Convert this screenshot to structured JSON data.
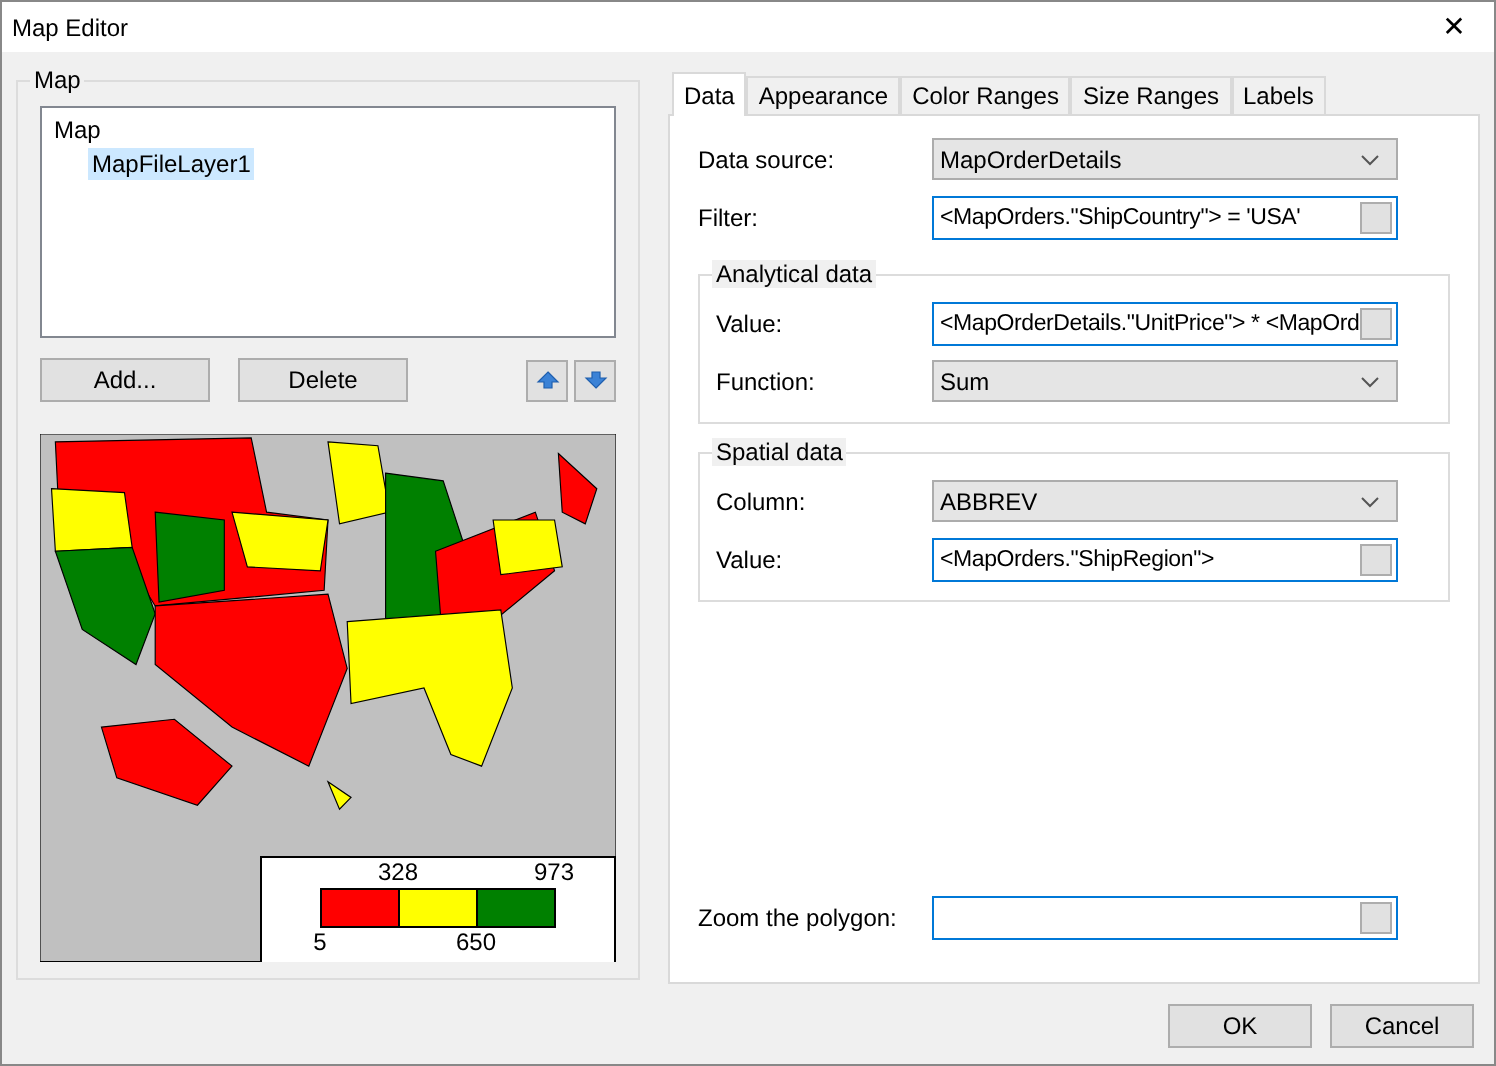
{
  "window": {
    "title": "Map Editor",
    "close": "✕"
  },
  "map_group": {
    "title": "Map",
    "tree": [
      {
        "label": "Map",
        "selected": false,
        "children": [
          {
            "label": "MapFileLayer1",
            "selected": true
          }
        ]
      }
    ],
    "buttons": [
      "Add...",
      "Delete"
    ],
    "legend": {
      "ranges": [
        {
          "color": "#ff0000"
        },
        {
          "color": "#ffff00"
        },
        {
          "color": "#008000"
        }
      ],
      "boundaries": [
        {
          "label": "5",
          "kind": "below"
        },
        {
          "label": "328",
          "kind": "above"
        },
        {
          "label": "650",
          "kind": "below"
        },
        {
          "label": "973",
          "kind": "above"
        }
      ]
    }
  },
  "tabs": [
    {
      "label": "Data",
      "selected": true
    },
    {
      "label": "Appearance",
      "selected": false
    },
    {
      "label": "Color Ranges",
      "selected": false
    },
    {
      "label": "Size Ranges",
      "selected": false
    },
    {
      "label": "Labels",
      "selected": false
    }
  ],
  "data_tab": {
    "rows": [
      {
        "kind": "dropdown",
        "label": "Data source:",
        "value": "MapOrderDetails"
      },
      {
        "kind": "text",
        "label": "Filter:",
        "value": "<MapOrders.\"ShipCountry\"> = 'USA'"
      }
    ],
    "groups": [
      {
        "title": "Analytical data",
        "rows": [
          {
            "kind": "text",
            "label": "Value:",
            "value": "<MapOrderDetails.\"UnitPrice\"> * <MapOrd"
          },
          {
            "kind": "dropdown",
            "label": "Function:",
            "value": "Sum"
          }
        ]
      },
      {
        "title": "Spatial data",
        "rows": [
          {
            "kind": "dropdown",
            "label": "Column:",
            "value": "ABBREV"
          },
          {
            "kind": "text",
            "label": "Value:",
            "value": "<MapOrders.\"ShipRegion\">"
          }
        ]
      }
    ],
    "bottom_rows": [
      {
        "kind": "text",
        "label": "Zoom the polygon:"
      }
    ]
  },
  "buttons": [
    "OK",
    "Cancel"
  ]
}
